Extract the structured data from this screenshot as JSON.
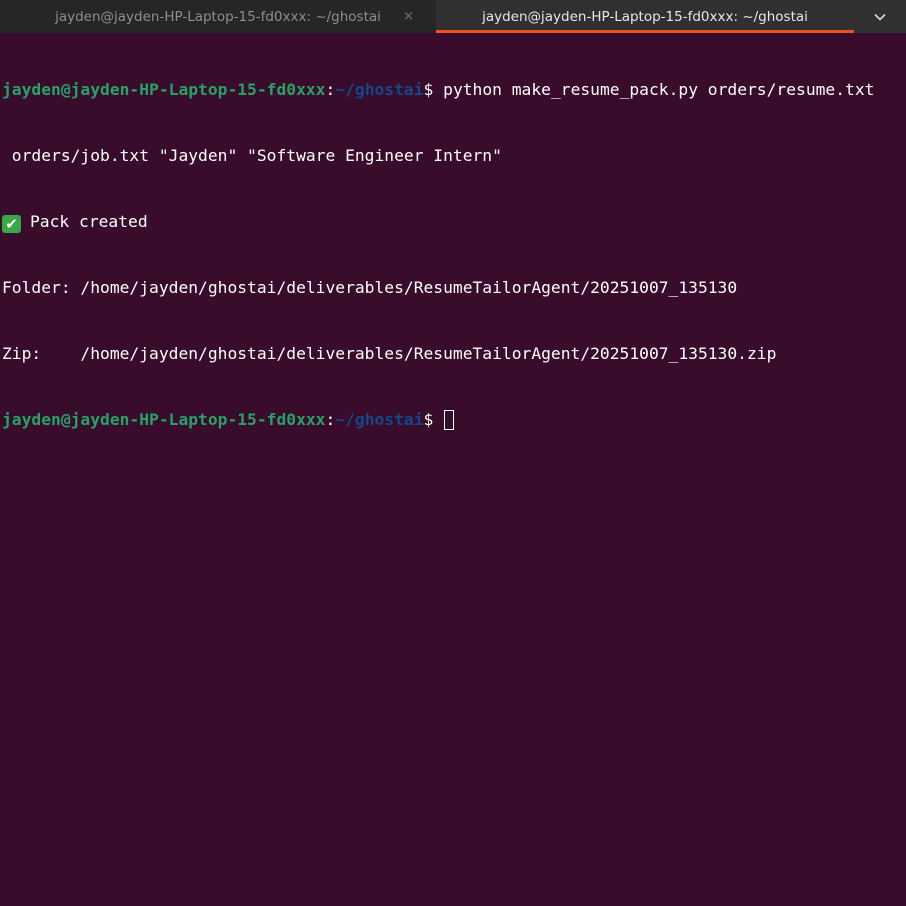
{
  "tabs": [
    {
      "title": "jayden@jayden-HP-Laptop-15-fd0xxx: ~/ghostai",
      "active": false,
      "close_icon": "close-icon"
    },
    {
      "title": "jayden@jayden-HP-Laptop-15-fd0xxx: ~/ghostai",
      "active": true
    }
  ],
  "tabs_menu_icon": "chevron-down-icon",
  "colors": {
    "background": "#380c2a",
    "prompt_user": "#26a269",
    "prompt_path": "#12488b",
    "text": "#ffffff",
    "active_tab_accent": "#e95420",
    "check_badge": "#3aa745"
  },
  "prompt": {
    "user_host": "jayden@jayden-HP-Laptop-15-fd0xxx",
    "separator": ":",
    "path": "~/ghostai",
    "symbol": "$ "
  },
  "terminal": {
    "command_line1": "python make_resume_pack.py orders/resume.txt",
    "command_line2": " orders/job.txt \"Jayden\" \"Software Engineer Intern\"",
    "status_icon": "✔",
    "status_text": "Pack created",
    "folder_line": "Folder: /home/jayden/ghostai/deliverables/ResumeTailorAgent/20251007_135130",
    "zip_line": "Zip:    /home/jayden/ghostai/deliverables/ResumeTailorAgent/20251007_135130.zip"
  }
}
